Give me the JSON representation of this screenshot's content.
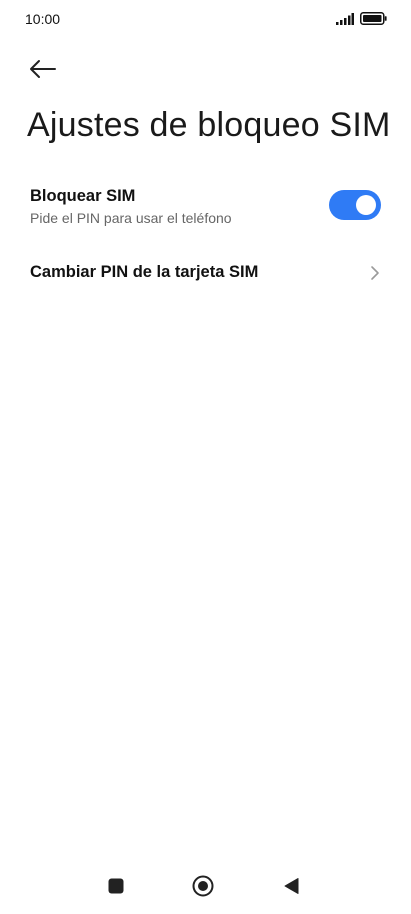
{
  "status_bar": {
    "time": "10:00",
    "icons": [
      "signal-icon",
      "battery-icon"
    ]
  },
  "header": {
    "back_icon": "arrow-left-icon",
    "title": "Ajustes de bloqueo SIM"
  },
  "settings": {
    "lock_sim": {
      "title": "Bloquear SIM",
      "subtitle": "Pide el PIN para usar el teléfono",
      "enabled": true
    },
    "change_pin": {
      "title": "Cambiar PIN de la tarjeta SIM",
      "icon": "chevron-right-icon"
    }
  },
  "nav_bar": {
    "buttons": [
      "recent-apps-icon",
      "home-icon",
      "back-triangle-icon"
    ]
  },
  "colors": {
    "accent": "#2f7bf5",
    "text_primary": "#111111",
    "text_secondary": "#666666",
    "icon_gray": "#9a9a9a"
  }
}
